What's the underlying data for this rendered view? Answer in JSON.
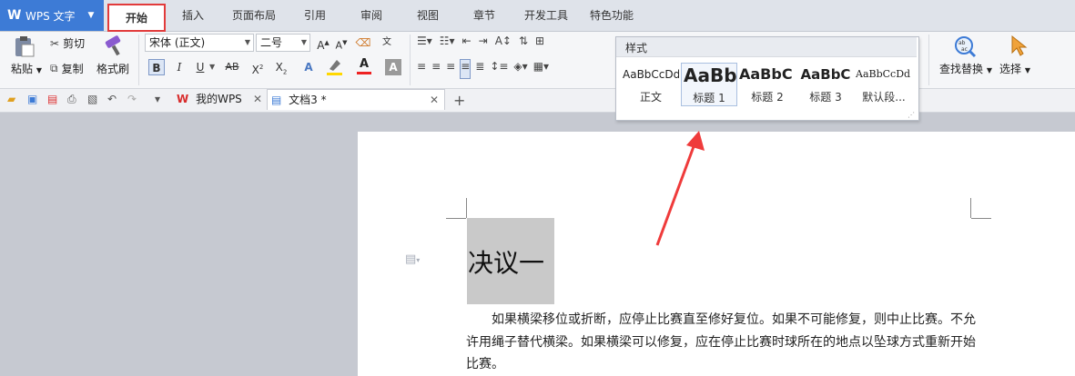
{
  "app": {
    "name": "WPS 文字",
    "logo": "W"
  },
  "ribbon_tabs": [
    "开始",
    "插入",
    "页面布局",
    "引用",
    "审阅",
    "视图",
    "章节",
    "开发工具",
    "特色功能"
  ],
  "clipboard": {
    "paste": "粘贴",
    "cut": "剪切",
    "copy": "复制",
    "format_painter": "格式刷"
  },
  "font": {
    "family": "宋体 (正文)",
    "size": "二号"
  },
  "styles_popup": {
    "title": "样式",
    "items": [
      {
        "preview": "AaBbCcDd",
        "name": "正文"
      },
      {
        "preview": "AaBb",
        "name": "标题 1"
      },
      {
        "preview": "AaBbC",
        "name": "标题 2"
      },
      {
        "preview": "AaBbC",
        "name": "标题 3"
      },
      {
        "preview": "AaBbCcDd",
        "name": "默认段..."
      }
    ]
  },
  "editing": {
    "find_replace": "查找替换",
    "select": "选择"
  },
  "doc_tabs": [
    {
      "name": "我的WPS"
    },
    {
      "name": "文档3 *"
    }
  ],
  "document": {
    "heading": "决议一",
    "paragraph_lines": [
      "如果横梁移位或折断，应停止比赛直至修好复位。如果不可能修复，则中止比赛。不允",
      "许用绳子替代横梁。如果横梁可以修复，应在停止比赛时球所在的地点以坠球方式重新开始",
      "比赛。"
    ]
  },
  "colors": {
    "accent": "#3d7bd6",
    "highlight_border": "#e23b3b",
    "arrow": "#ef3b3b"
  }
}
